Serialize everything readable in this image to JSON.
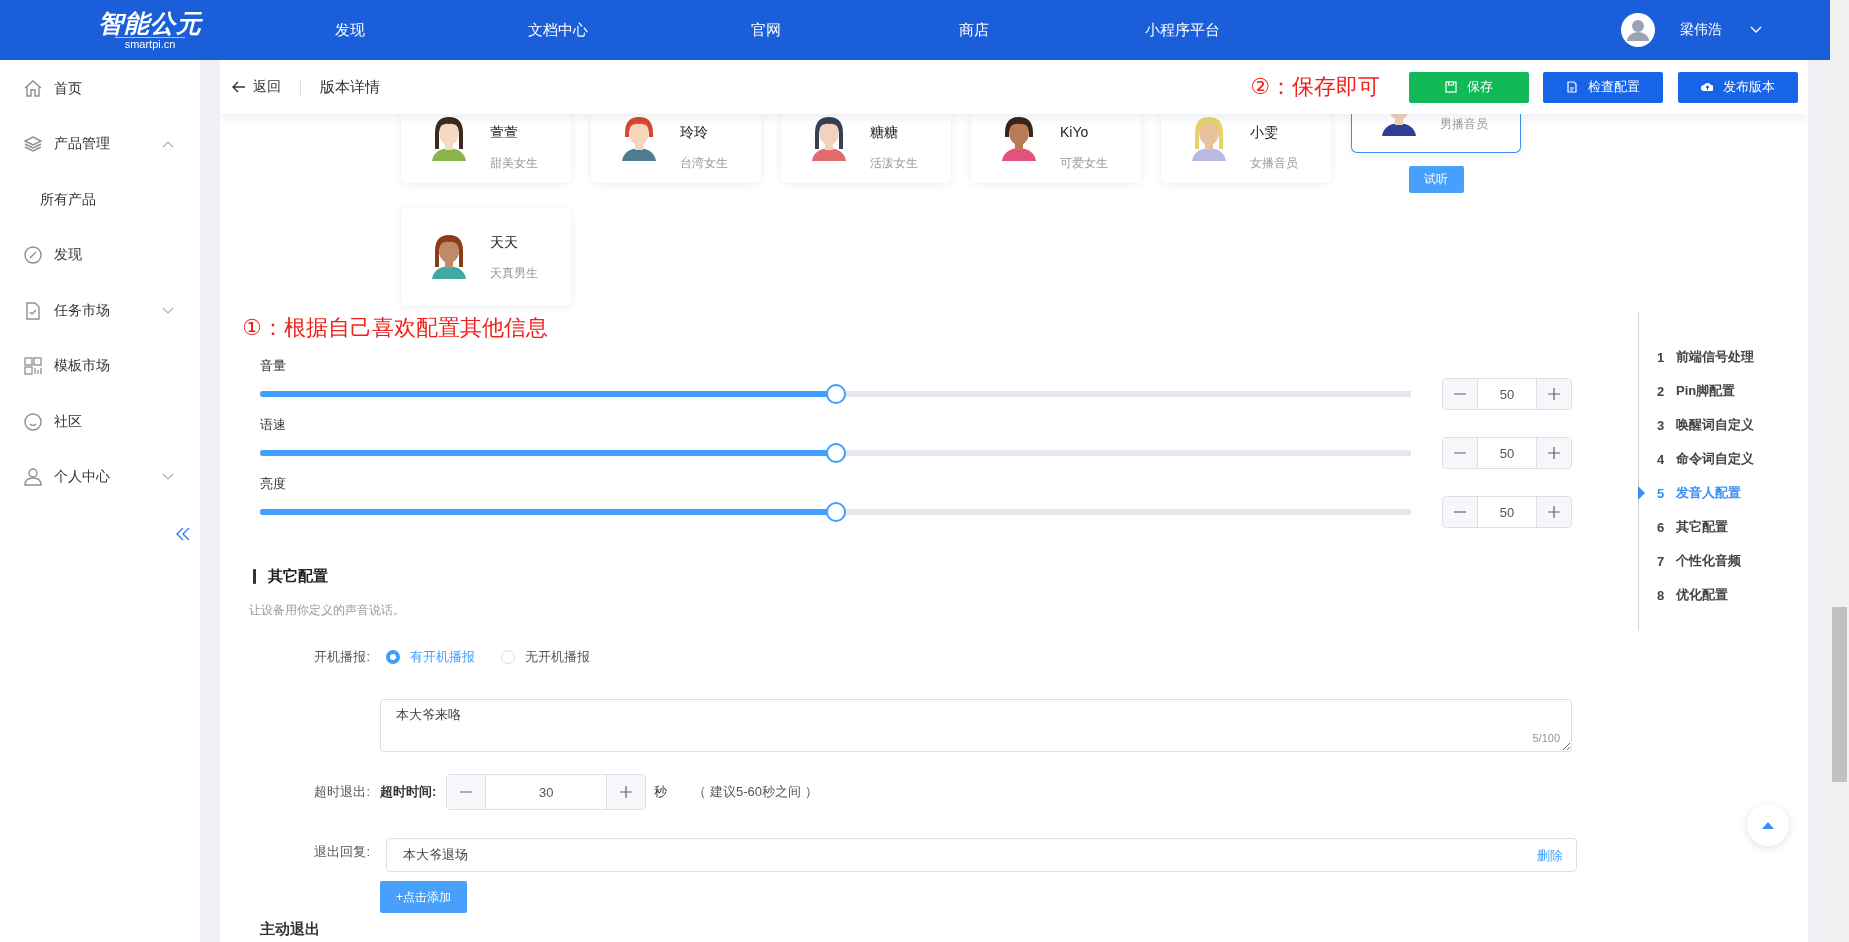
{
  "topbar": {
    "logo": {
      "title": "智能公元",
      "subtitle": "smartpi.cn"
    },
    "nav": [
      {
        "label": "发现"
      },
      {
        "label": "文档中心"
      },
      {
        "label": "官网"
      },
      {
        "label": "商店"
      },
      {
        "label": "小程序平台"
      }
    ],
    "user": {
      "name": "梁伟浩"
    }
  },
  "sidebar": {
    "items": [
      {
        "label": "首页",
        "kind": "home"
      },
      {
        "label": "产品管理",
        "kind": "layers",
        "expanded": true,
        "children": [
          {
            "label": "所有产品"
          }
        ]
      },
      {
        "label": "发现",
        "kind": "compass"
      },
      {
        "label": "任务市场",
        "kind": "task",
        "expanded": false
      },
      {
        "label": "模板市场",
        "kind": "grid"
      },
      {
        "label": "社区",
        "kind": "smile"
      },
      {
        "label": "个人中心",
        "kind": "person",
        "expanded": false
      }
    ]
  },
  "header": {
    "back": "返回",
    "title": "版本详情",
    "note": "②：保存即可",
    "buttons": [
      {
        "label": "保存",
        "kind": "save"
      },
      {
        "label": "检查配置",
        "kind": "check"
      },
      {
        "label": "发布版本",
        "kind": "publish"
      }
    ]
  },
  "voices": {
    "cards": [
      {
        "name": "萱萱",
        "desc": "甜美女生",
        "selected": false
      },
      {
        "name": "玲玲",
        "desc": "台湾女生",
        "selected": false
      },
      {
        "name": "糖糖",
        "desc": "活泼女生",
        "selected": false
      },
      {
        "name": "KiYo",
        "desc": "可爱女生",
        "selected": false
      },
      {
        "name": "小雯",
        "desc": "女播音员",
        "selected": false
      },
      {
        "desc": "男播音员",
        "selected": true
      },
      {
        "name": "天天",
        "desc": "天真男生",
        "selected": false
      }
    ],
    "listen_button": "试听"
  },
  "annotation": "①：根据自己喜欢配置其他信息",
  "sliders": [
    {
      "label": "音量",
      "level": 0.5,
      "value": "50"
    },
    {
      "label": "语速",
      "level": 0.5,
      "value": "50"
    },
    {
      "label": "亮度",
      "level": 0.5,
      "value": "50"
    }
  ],
  "anchor_nav": [
    {
      "number": "1",
      "label": "前端信号处理",
      "selected": false
    },
    {
      "number": "2",
      "label": "Pin脚配置",
      "selected": false
    },
    {
      "number": "3",
      "label": "唤醒词自定义",
      "selected": false
    },
    {
      "number": "4",
      "label": "命令词自定义",
      "selected": false
    },
    {
      "number": "5",
      "label": "发音人配置",
      "selected": true
    },
    {
      "number": "6",
      "label": "其它配置",
      "selected": false
    },
    {
      "number": "7",
      "label": "个性化音频",
      "selected": false
    },
    {
      "number": "8",
      "label": "优化配置",
      "selected": false
    }
  ],
  "other_config": {
    "title": "其它配置",
    "description": "让设备用你定义的声音说话。",
    "boot_announce": {
      "label": "开机播报:",
      "options": [
        {
          "label": "有开机播报",
          "selected": true
        },
        {
          "label": "无开机播报",
          "selected": false
        }
      ],
      "text": "本大爷来咯",
      "counter": "5/100"
    },
    "timeout": {
      "label": "超时退出:",
      "field_label": "超时时间:",
      "value": "30",
      "unit": "秒",
      "hint": "（ 建议5-60秒之间 ）"
    },
    "exit_reply": {
      "label": "退出回复:",
      "entries": [
        {
          "value": "本大爷退场",
          "action": "删除"
        }
      ],
      "add_button": "+点击添加"
    },
    "next_section_title": "主动退出"
  }
}
